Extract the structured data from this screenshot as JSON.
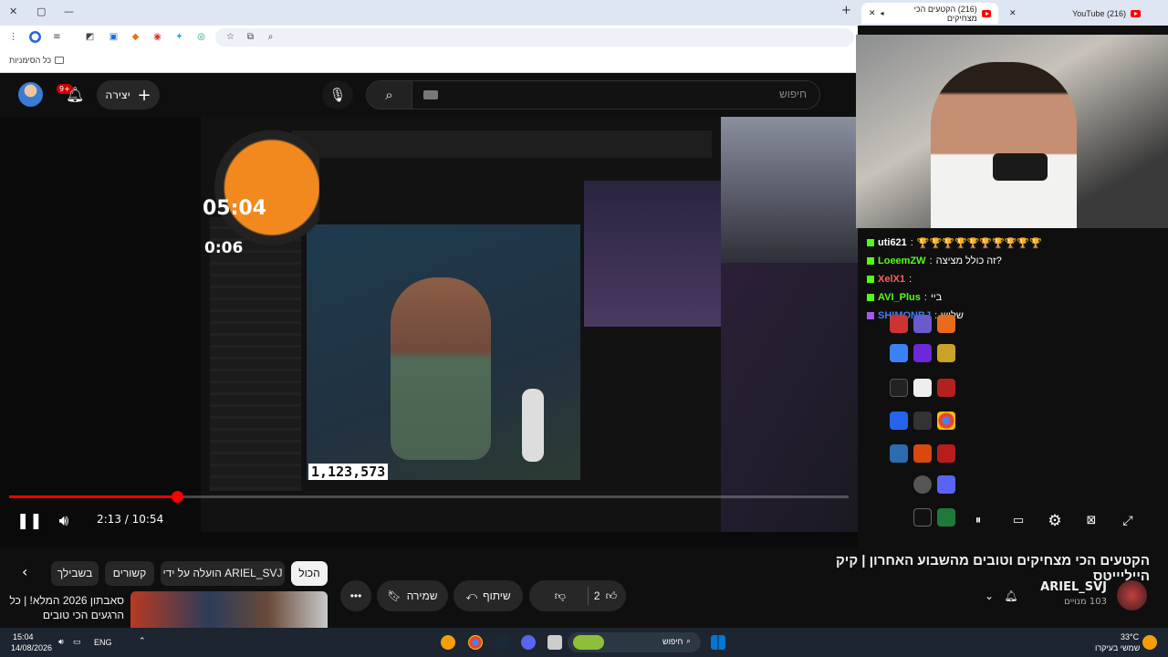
{
  "browser": {
    "tabs": [
      {
        "label": "(216) YouTube",
        "active": false
      },
      {
        "label": "(216) הקטעים הכי מצחיקים",
        "active": true
      }
    ],
    "bookmarks_label": "כל הסימניות",
    "window_controls": [
      "✕",
      "▢",
      "—"
    ]
  },
  "header": {
    "notification_count": "9+",
    "create_label": "יצירה",
    "search_placeholder": "חיפוש"
  },
  "video": {
    "overlay_timer_main": "05:04",
    "overlay_timer_secondary": "0:06",
    "overlay_view_count": "1,123,573",
    "current_time": "2:13",
    "duration": "10:54",
    "time_display": "2:13 / 10:54",
    "progress_fraction": 0.2
  },
  "stream_chat": [
    {
      "user": "uti621",
      "message": "🏆🏆🏆🏆🏆🏆🏆🏆🏆🏆",
      "color": "#ffffff"
    },
    {
      "user": "LoeemZW",
      "message": "זה כולל מציצה?",
      "color": "#53fc18"
    },
    {
      "user": "XelX1",
      "message": "",
      "color": "#ff5f5f"
    },
    {
      "user": "AVI_Plus",
      "message": "ביי",
      "color": "#53fc18"
    },
    {
      "user": "SHIMONBJ",
      "message": "שלוש",
      "color": "#3b82f6"
    }
  ],
  "title": "הקטעים הכי מצחיקים וטובים מהשבוע האחרון | קיק הייליייטס",
  "channel": {
    "name": "ARIEL_SVJ",
    "subscribers": "103 מנויים"
  },
  "actions": {
    "like_count": "2",
    "share_label": "שיתוף",
    "save_label": "שמירה",
    "more_label": "•••"
  },
  "chips": [
    {
      "label": "הכול",
      "active": true
    },
    {
      "label": "הועלה על ידי ARIEL_SVJ",
      "active": false
    },
    {
      "label": "קשורים",
      "active": false
    },
    {
      "label": "בשבילך",
      "active": false
    }
  ],
  "recommendation": {
    "title": "סאבתון 2026 המלא! | כל הרגעים הכי טובים"
  },
  "taskbar": {
    "time": "15:04",
    "date": "14/08/2026",
    "language": "ENG",
    "search_label": "חיפוש",
    "weather_temp": "33°C",
    "weather_desc": "שמשי בעיקרו"
  },
  "colors": {
    "accent_red": "#ff0000",
    "kick_green": "#53fc18",
    "background": "#0f0f0f"
  }
}
